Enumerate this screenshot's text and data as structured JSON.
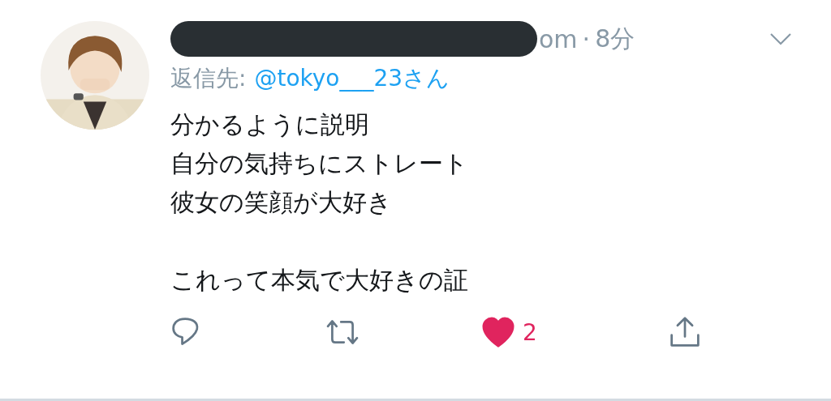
{
  "tweet": {
    "name_visible_tail": "om",
    "separator": "·",
    "time": "8分",
    "reply_prefix": "返信先:",
    "reply_to": "@tokyo___23さん",
    "paragraphs": [
      [
        "分かるように説明",
        "自分の気持ちにストレート",
        "彼女の笑顔が大好き"
      ],
      [
        "これって本気で大好きの証"
      ]
    ],
    "like_count": "2",
    "liked": true
  }
}
